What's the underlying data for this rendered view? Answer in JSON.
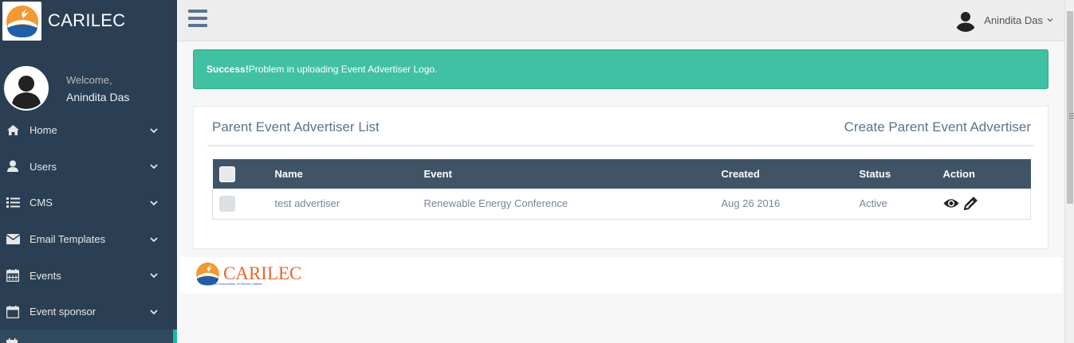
{
  "brand": {
    "title": "CARILEC"
  },
  "profile": {
    "welcome": "Welcome,",
    "name": "Anindita Das"
  },
  "sidebar": {
    "items": [
      {
        "label": "Home",
        "icon": "home-icon"
      },
      {
        "label": "Users",
        "icon": "user-icon"
      },
      {
        "label": "CMS",
        "icon": "list-icon"
      },
      {
        "label": "Email Templates",
        "icon": "envelope-icon"
      },
      {
        "label": "Events",
        "icon": "calendar-icon"
      },
      {
        "label": "Event sponsor",
        "icon": "calendar-icon"
      }
    ]
  },
  "topnav": {
    "user_name": "Anindita Das"
  },
  "alert": {
    "strong": "Success!",
    "message": "Problem in uploading Event Advertiser Logo."
  },
  "panel": {
    "title": "Parent Event Advertiser List",
    "create_label": "Create Parent Event Advertiser"
  },
  "table": {
    "headers": [
      "Name",
      "Event",
      "Created",
      "Status",
      "Action"
    ],
    "rows": [
      {
        "name": "test advertiser",
        "event": "Renewable Energy Conference",
        "created": "Aug 26 2016",
        "status": "Active"
      }
    ]
  },
  "footer": {
    "brand": "CARILEC",
    "tagline": "An Association Of Electric Utilities"
  },
  "colors": {
    "sidebar": "#2a3f54",
    "accent": "#1abb9c",
    "alert": "#40c1a3",
    "table_header": "#405467",
    "text_muted": "#73879c"
  }
}
